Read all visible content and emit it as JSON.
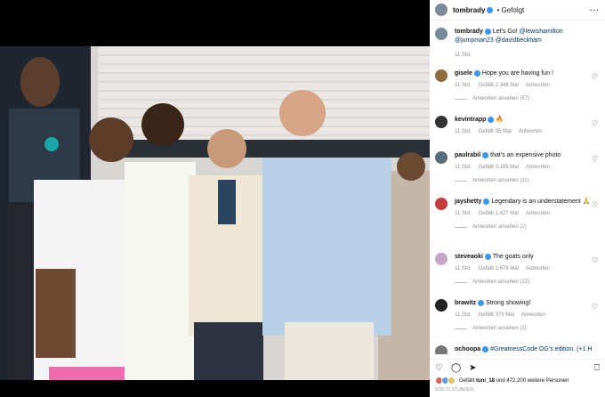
{
  "post": {
    "username": "tombrady",
    "follow_state": "Gefolgt",
    "more": "···",
    "caption_text": "Let's Go!",
    "caption_mentions": [
      "@lewishamilton",
      "@jumpman23",
      "@davidbeckham"
    ],
    "caption_time": "11 Std."
  },
  "comments": [
    {
      "user": "gisele",
      "text": "Hope you are having fun !",
      "time": "11 Std.",
      "likes": "Gefällt 2.346 Mal",
      "reply": "Antworten",
      "view_replies": "Antworten ansehen (57)",
      "avatar_color": "#8d6b3a"
    },
    {
      "user": "kevintrapp",
      "text": "🔥",
      "time": "11 Std.",
      "likes": "Gefällt 35 Mal",
      "reply": "Antworten",
      "view_replies": "",
      "avatar_color": "#333333"
    },
    {
      "user": "paulrabil",
      "text": "that's an expensive photo",
      "time": "11 Std.",
      "likes": "Gefällt 3.165 Mal",
      "reply": "Antworten",
      "view_replies": "Antworten ansehen (11)",
      "avatar_color": "#5a6d7d"
    },
    {
      "user": "jayshetty",
      "text": "Legendary is an understatement 🙏",
      "time": "11 Std.",
      "likes": "Gefällt 1.427 Mal",
      "reply": "Antworten",
      "view_replies": "Antworten ansehen (2)",
      "avatar_color": "#c43c3c"
    },
    {
      "user": "steveaoki",
      "text": "The goats only",
      "time": "11 Std.",
      "likes": "Gefällt 1.678 Mal",
      "reply": "Antworten",
      "view_replies": "Antworten ansehen (22)",
      "avatar_color": "#c9a6c9"
    },
    {
      "user": "brawitz",
      "text": "Strong showing!",
      "time": "11 Std.",
      "likes": "Gefällt 379 Mal",
      "reply": "Antworten",
      "view_replies": "Antworten ansehen (2)",
      "avatar_color": "#222222"
    }
  ],
  "partial_comment": {
    "user": "ochoopa",
    "text": "#GreatnessCode OG's edition. (+1 H"
  },
  "footer": {
    "liked_by_prefix": "Gefällt",
    "liked_by_user": "tuni_18",
    "liked_by_rest": "und 472.200 weitere Personen",
    "timestamp": "VOR 11 STUNDEN"
  },
  "colors": {
    "verified": "#3897f0",
    "link": "#00376b",
    "muted": "#8e8e8e"
  },
  "icons": [
    "heart-icon",
    "comment-icon",
    "share-icon",
    "bookmark-icon",
    "more-icon"
  ]
}
